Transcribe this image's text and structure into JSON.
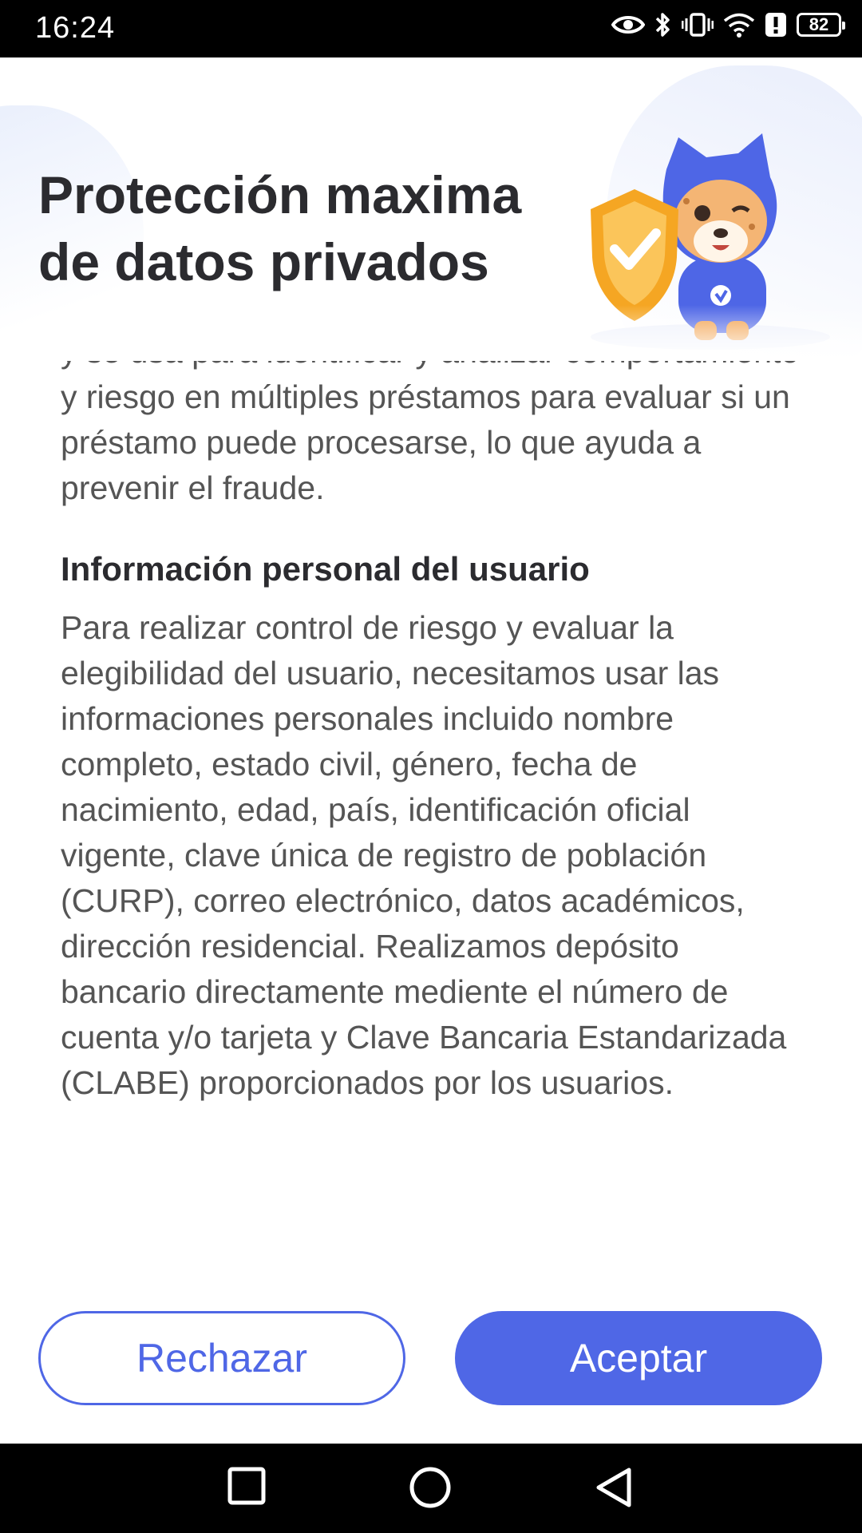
{
  "status_bar": {
    "time": "16:24",
    "battery_level": "82",
    "icons": [
      "eye-icon",
      "bluetooth-icon",
      "vibrate-icon",
      "wifi-icon",
      "alert-icon",
      "battery-icon"
    ]
  },
  "header": {
    "title_line1": "Protección maxima",
    "title_line2": "de datos privados"
  },
  "content": {
    "intro_partial": "y se usa para identificar y analizar comportamiento y riesgo en múltiples préstamos para evaluar si un préstamo puede procesarse, lo que ayuda a prevenir el fraude.",
    "section_title": "Información personal del usuario",
    "section_body": "Para realizar control de riesgo y evaluar la elegibilidad del usuario, necesitamos usar las informaciones personales incluido nombre completo, estado civil, género, fecha de nacimiento, edad, país, identificación oficial vigente, clave única de registro de población (CURP), correo electrónico, datos académicos, dirección residencial. Realizamos depósito bancario directamente mediente el número de cuenta y/o tarjeta y Clave Bancaria Estandarizada (CLABE) proporcionados por los usuarios."
  },
  "actions": {
    "reject_label": "Rechazar",
    "accept_label": "Aceptar"
  },
  "colors": {
    "accent": "#4f67e6",
    "title_text": "#2b2b2f",
    "body_text": "#555555"
  }
}
